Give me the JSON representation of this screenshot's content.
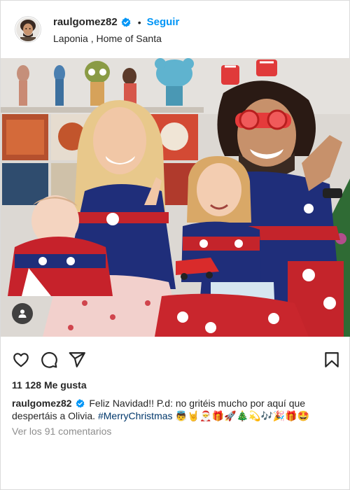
{
  "header": {
    "username": "raulgomez82",
    "separator": "•",
    "follow_label": "Seguir",
    "location": "Laponia , Home of Santa"
  },
  "actions": {
    "like_icon": "heart-icon",
    "comment_icon": "comment-icon",
    "share_icon": "paper-plane-icon",
    "save_icon": "bookmark-icon"
  },
  "likes": "11 128 Me gusta",
  "caption": {
    "username": "raulgomez82",
    "text": "Feliz Navidad!! P.d: no gritéis mucho por aquí que despertáis a Olivia.",
    "hashtag": "#MerryChristmas",
    "emojis": "👼🤘🎅🎁🚀🎄💫🎶🎉🎁🤩"
  },
  "view_comments": "Ver los 91 comentarios",
  "colors": {
    "accent": "#0095f6",
    "verified": "#0095f6",
    "hashtag": "#00376b",
    "muted": "#8e8e8e"
  }
}
